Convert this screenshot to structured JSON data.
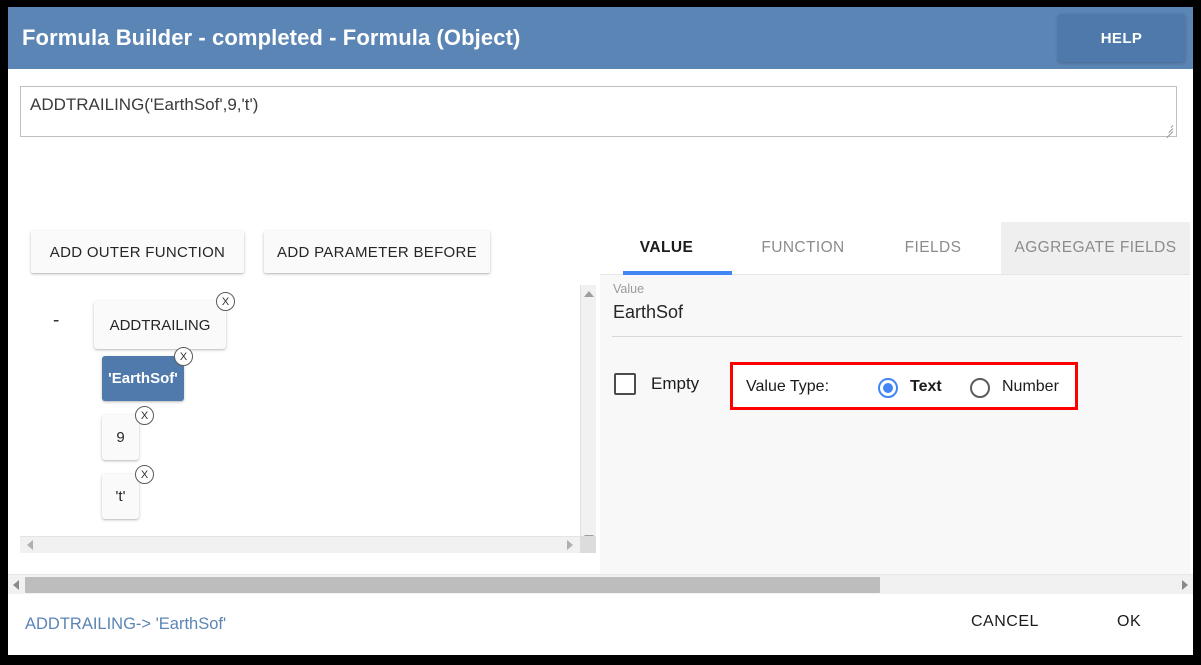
{
  "window": {
    "title": "Formula Builder - completed - Formula (Object)",
    "help_label": "HELP"
  },
  "formula": {
    "text": "ADDTRAILING('EarthSof',9,'t')"
  },
  "actions": {
    "add_outer_function": "ADD OUTER FUNCTION",
    "add_parameter_before": "ADD PARAMETER BEFORE"
  },
  "tree": {
    "bullet": "-",
    "delete_badge": "X",
    "nodes": [
      {
        "label": "ADDTRAILING",
        "selected": false
      },
      {
        "label": "'EarthSof'",
        "selected": true
      },
      {
        "label": "9",
        "selected": false
      },
      {
        "label": "'t'",
        "selected": false
      }
    ]
  },
  "tabs": [
    {
      "label": "VALUE",
      "state": "active"
    },
    {
      "label": "FUNCTION",
      "state": "inactive"
    },
    {
      "label": "FIELDS",
      "state": "inactive"
    },
    {
      "label": "AGGREGATE FIELDS",
      "state": "hovered"
    }
  ],
  "value_panel": {
    "field_label": "Value",
    "field_value": "EarthSof",
    "empty_label": "Empty",
    "empty_checked": false,
    "value_type_caption": "Value Type:",
    "options": [
      {
        "label": "Text",
        "selected": true
      },
      {
        "label": "Number",
        "selected": false
      }
    ],
    "highlight_color": "#ff0000"
  },
  "footer": {
    "breadcrumb": "ADDTRAILING-> 'EarthSof'",
    "cancel_label": "CANCEL",
    "ok_label": "OK"
  },
  "colors": {
    "titlebar": "#5b85b5",
    "help_button": "#4f79aa",
    "selected_chip": "#4f7aab",
    "tab_accent": "#4285f4",
    "breadcrumb": "#5b85b5",
    "highlight": "#ff0000"
  }
}
